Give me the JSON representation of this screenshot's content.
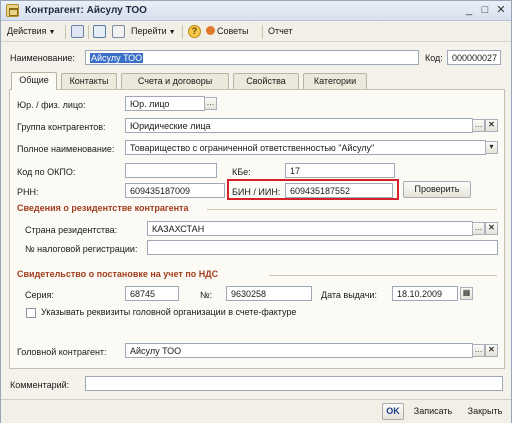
{
  "window": {
    "title": "Контрагент: Айсулу ТОО",
    "minimize": "_",
    "maximize": "□",
    "close": "✕"
  },
  "toolbar": {
    "actions": "Действия",
    "goto": "Перейти",
    "help": "?",
    "tips": "Советы",
    "report": "Отчет"
  },
  "header": {
    "name_label": "Наименование:",
    "name_value": "Айсулу ТОО",
    "code_label": "Код:",
    "code_value": "000000027"
  },
  "tabs": [
    {
      "label": "Общие"
    },
    {
      "label": "Контакты"
    },
    {
      "label": "Счета и договоры"
    },
    {
      "label": "Свойства"
    },
    {
      "label": "Категории"
    }
  ],
  "general": {
    "legal_label": "Юр. / физ. лицо:",
    "legal_value": "Юр. лицо",
    "group_label": "Группа контрагентов:",
    "group_value": "Юридические лица",
    "fullname_label": "Полное наименование:",
    "fullname_value": "Товарищество с ограниченной ответственностью \"Айсулу\"",
    "okpo_label": "Код по ОКПО:",
    "okpo_value": "",
    "kbe_label": "КБе:",
    "kbe_value": "17",
    "rnn_label": "РНН:",
    "rnn_value": "609435187009",
    "bin_label": "БИН / ИИН:",
    "bin_value": "609435187552",
    "check_button": "Проверить"
  },
  "residency": {
    "title": "Сведения о резидентстве контрагента",
    "country_label": "Страна резидентства:",
    "country_value": "КАЗАХСТАН",
    "tax_reg_label": "№ налоговой регистрации:",
    "tax_reg_value": ""
  },
  "vat": {
    "title": "Свидетельство о постановке на учет по НДС",
    "series_label": "Серия:",
    "series_value": "68745",
    "number_label": "№:",
    "number_value": "9630258",
    "date_label": "Дата выдачи:",
    "date_value": "18.10.2009",
    "head_org_checkbox_label": "Указывать реквизиты головной организации в счете-фактуре"
  },
  "head": {
    "label": "Головной контрагент:",
    "value": "Айсулу ТОО"
  },
  "comment": {
    "label": "Комментарий:",
    "value": ""
  },
  "footer": {
    "ok": "OK",
    "save": "Записать",
    "close": "Закрыть"
  },
  "colors": {
    "section_title": "#a23c1c",
    "highlight": "#d4222a",
    "selection": "#3a6fc8"
  }
}
